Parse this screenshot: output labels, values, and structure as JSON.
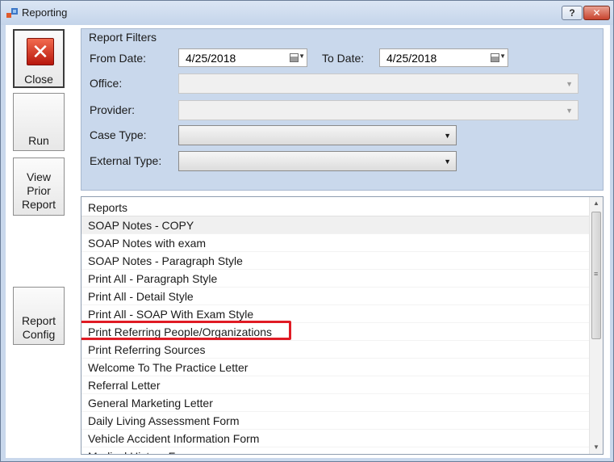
{
  "window": {
    "title": "Reporting",
    "help_label": "?",
    "close_label": "✕"
  },
  "side_buttons": {
    "close": "Close",
    "run": "Run",
    "view_prior": [
      "View",
      "Prior",
      "Report"
    ],
    "report_config": [
      "Report",
      "Config"
    ]
  },
  "filters": {
    "group_title": "Report Filters",
    "from_date_label": "From Date:",
    "from_date_value": "4/25/2018",
    "to_date_label": "To Date:",
    "to_date_value": "4/25/2018",
    "office_label": "Office:",
    "office_value": "",
    "provider_label": "Provider:",
    "provider_value": "",
    "case_type_label": "Case Type:",
    "case_type_value": "",
    "external_type_label": "External Type:",
    "external_type_value": ""
  },
  "reports": {
    "header": "Reports",
    "items": [
      "SOAP Notes - COPY",
      "SOAP Notes with exam",
      "SOAP Notes - Paragraph Style",
      "Print All - Paragraph Style",
      "Print All - Detail Style",
      "Print All - SOAP With Exam Style",
      "Print Referring People/Organizations",
      "Print Referring Sources",
      "Welcome To The Practice Letter",
      "Referral Letter",
      "General Marketing Letter",
      "Daily Living Assessment Form",
      "Vehicle Accident Information Form",
      "Medical History Form"
    ],
    "selected_index": 0,
    "highlighted_index": 6
  },
  "colors": {
    "highlight": "#e01b24",
    "window_bg": "#c9d8ec"
  }
}
